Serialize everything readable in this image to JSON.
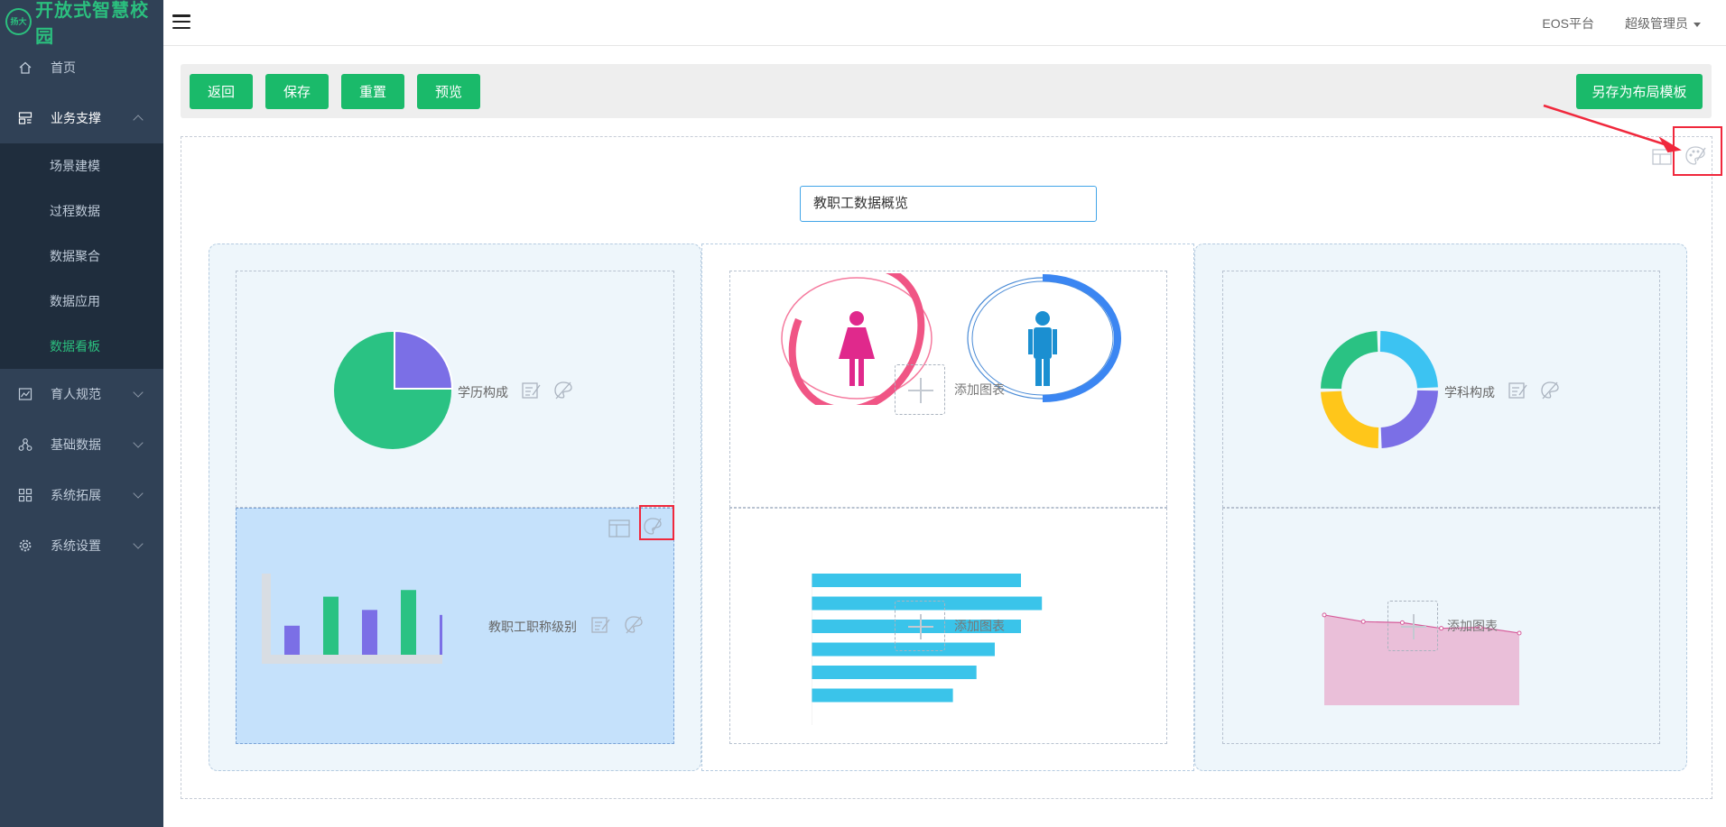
{
  "brand": {
    "title": "开放式智慧校园",
    "mark": "扬大"
  },
  "sidebar": {
    "items": [
      {
        "label": "首页",
        "icon": "home-icon"
      },
      {
        "label": "业务支撑",
        "icon": "dashboard-icon",
        "expanded": true,
        "children": [
          "场景建模",
          "过程数据",
          "数据聚合",
          "数据应用",
          "数据看板"
        ],
        "active_child": "数据看板"
      },
      {
        "label": "育人规范",
        "icon": "chart-icon"
      },
      {
        "label": "基础数据",
        "icon": "nodes-icon"
      },
      {
        "label": "系统拓展",
        "icon": "grid-icon"
      },
      {
        "label": "系统设置",
        "icon": "gear-icon"
      }
    ]
  },
  "topbar": {
    "platform": "EOS平台",
    "user": "超级管理员"
  },
  "toolbar": {
    "back": "返回",
    "save": "保存",
    "reset": "重置",
    "preview": "预览",
    "save_template": "另存为布局模板"
  },
  "board": {
    "title_value": "教职工数据概览",
    "cells": {
      "education": "学历构成",
      "title_level": "教职工职称级别",
      "subject": "学科构成",
      "add_chart": "添加图表"
    }
  },
  "colors": {
    "accent": "#1aba6a",
    "sidebar": "#304156",
    "highlight": "#f0283c"
  },
  "chart_data": [
    {
      "type": "pie",
      "values": [
        25,
        75
      ],
      "label": "学历构成",
      "colors": [
        "#7b6fe6",
        "#2ac283"
      ]
    },
    {
      "type": "bar",
      "label": "教职工职称级别",
      "values": [
        35,
        70,
        54,
        78,
        48
      ],
      "colors": [
        "#7b6fe6",
        "#2ac283",
        "#7b6fe6",
        "#2ac283",
        "#7b6fe6"
      ]
    },
    {
      "type": "pie",
      "label": "学科构成",
      "values": [
        25,
        25,
        25,
        25
      ],
      "colors": [
        "#3cc3f2",
        "#7b6fe6",
        "#ffc61a",
        "#2ac283"
      ]
    },
    {
      "type": "bar",
      "orientation": "horizontal",
      "values": [
        80,
        88,
        80,
        70,
        63,
        54
      ]
    },
    {
      "type": "area",
      "values": [
        95,
        88,
        87,
        81,
        82,
        76
      ]
    }
  ]
}
